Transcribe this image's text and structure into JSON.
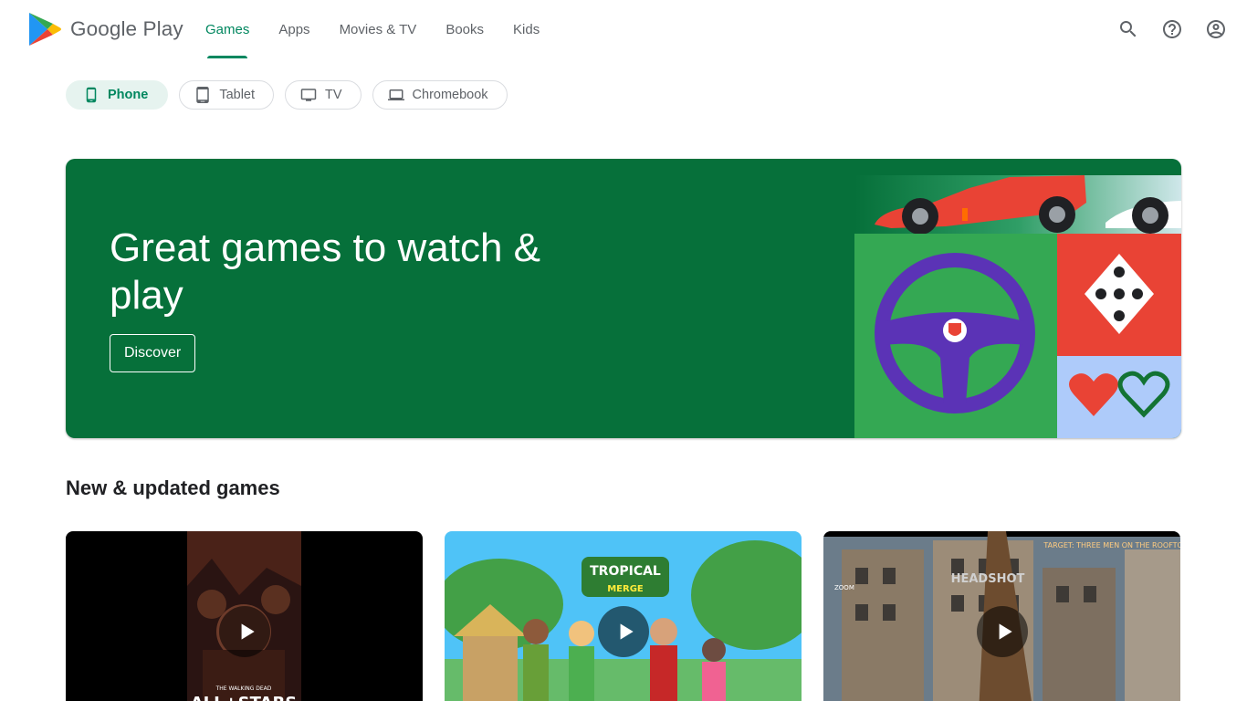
{
  "brand": {
    "name": "Google Play",
    "colors": {
      "accent": "#01875f",
      "hero_bg": "#06703a",
      "chip_active_bg": "#e6f3ef"
    }
  },
  "nav": {
    "tabs": [
      {
        "label": "Games",
        "active": true
      },
      {
        "label": "Apps",
        "active": false
      },
      {
        "label": "Movies & TV",
        "active": false
      },
      {
        "label": "Books",
        "active": false
      },
      {
        "label": "Kids",
        "active": false
      }
    ]
  },
  "header_icons": [
    "search-icon",
    "help-icon",
    "account-icon"
  ],
  "device_chips": [
    {
      "label": "Phone",
      "icon": "phone-icon",
      "active": true
    },
    {
      "label": "Tablet",
      "icon": "tablet-icon",
      "active": false
    },
    {
      "label": "TV",
      "icon": "tv-icon",
      "active": false
    },
    {
      "label": "Chromebook",
      "icon": "laptop-icon",
      "active": false
    }
  ],
  "hero": {
    "title": "Great games to watch & play",
    "button_label": "Discover"
  },
  "section": {
    "title": "New & updated games",
    "cards": [
      {
        "name": "walking-dead-all-stars",
        "caption": "THE WALKING DEAD ALL STARS"
      },
      {
        "name": "tropical-merge",
        "caption": "TROPICAL MERGE"
      },
      {
        "name": "sniper-headshot",
        "caption": "HEADSHOT",
        "target_text": "TARGET: THREE MEN ON THE ROOFTOP",
        "zoom_label": "ZOOM"
      }
    ]
  }
}
